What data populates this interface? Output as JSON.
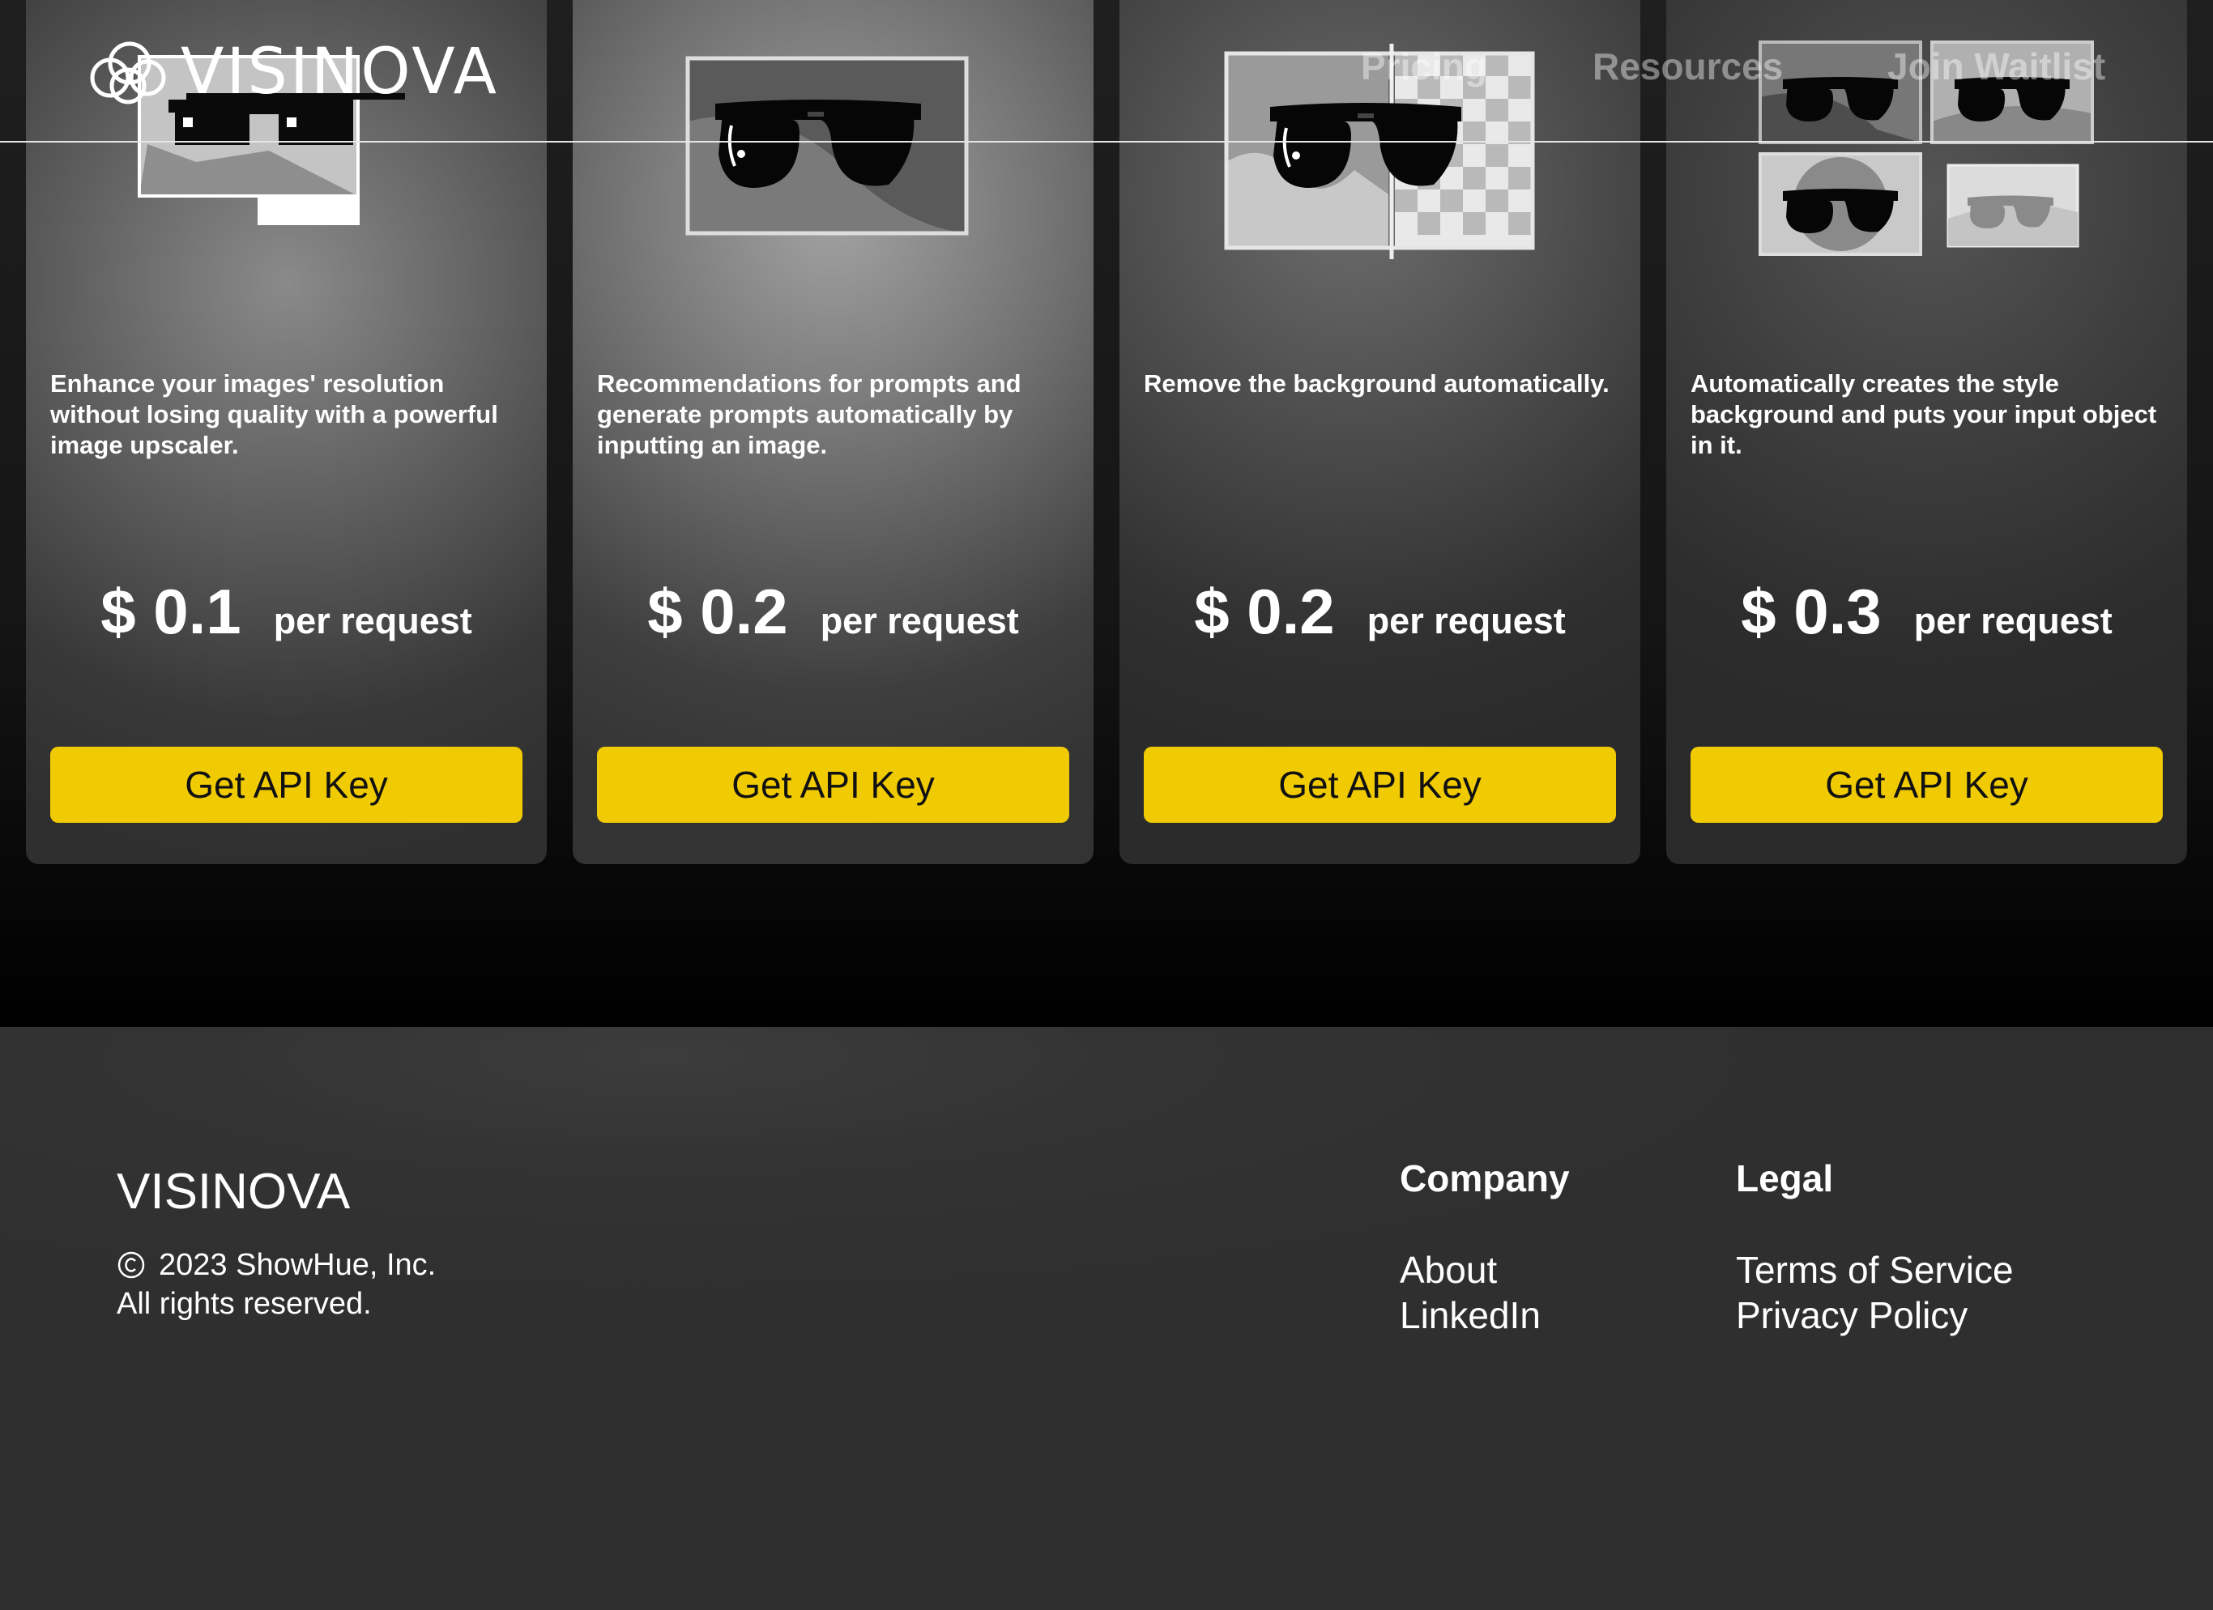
{
  "header": {
    "brand": "VISINOVA",
    "nav": [
      {
        "label": "Pricing"
      },
      {
        "label": "Resources"
      },
      {
        "label": "Join Waitlist"
      }
    ]
  },
  "cards": [
    {
      "description": "Enhance your images' resolution without losing quality with a powerful image upscaler.",
      "price": "$ 0.1",
      "unit": "per request",
      "button": "Get API Key",
      "icon": "pixel-sunglasses-upscale-icon"
    },
    {
      "description": "Recommendations for prompts and generate prompts automatically by inputting an image.",
      "price": "$ 0.2",
      "unit": "per request",
      "button": "Get API Key",
      "icon": "sunglasses-photo-icon"
    },
    {
      "description": "Remove the background automatically.",
      "price": "$ 0.2",
      "unit": "per request",
      "button": "Get API Key",
      "icon": "background-removal-icon"
    },
    {
      "description": "Automatically creates the style background and puts your input object in it.",
      "price": "$ 0.3",
      "unit": "per request",
      "button": "Get API Key",
      "icon": "style-background-grid-icon"
    }
  ],
  "footer": {
    "brand": "VISINOVA",
    "copyright_line1": "2023 ShowHue, Inc.",
    "copyright_line2": "All rights reserved.",
    "company": {
      "heading": "Company",
      "links": [
        "About",
        "LinkedIn"
      ]
    },
    "legal": {
      "heading": "Legal",
      "links": [
        "Terms of Service",
        "Privacy Policy"
      ]
    }
  },
  "colors": {
    "accent_button": "#f0ca03",
    "footer_bg": "#333333",
    "page_bg": "#000000"
  }
}
